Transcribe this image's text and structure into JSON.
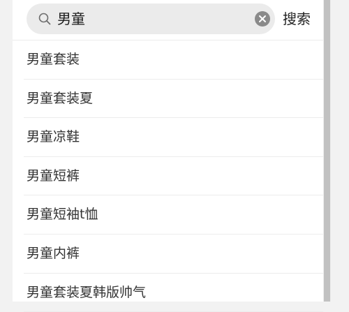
{
  "search": {
    "query": "男童",
    "button_label": "搜索",
    "search_icon": "search-icon",
    "clear_icon": "clear-icon"
  },
  "suggestions": [
    {
      "label": "男童套装"
    },
    {
      "label": "男童套装夏"
    },
    {
      "label": "男童凉鞋"
    },
    {
      "label": "男童短裤"
    },
    {
      "label": "男童短袖t恤"
    },
    {
      "label": "男童内裤"
    },
    {
      "label": "男童套装夏韩版帅气"
    }
  ],
  "colors": {
    "page_background": "#f2f2f2",
    "panel_background": "#ffffff",
    "search_field_background": "#ebebeb",
    "clear_icon_background": "#8a8a8a",
    "text_primary": "#333333",
    "divider": "#ececec",
    "scrollbar_thumb": "#c1c1c1"
  }
}
